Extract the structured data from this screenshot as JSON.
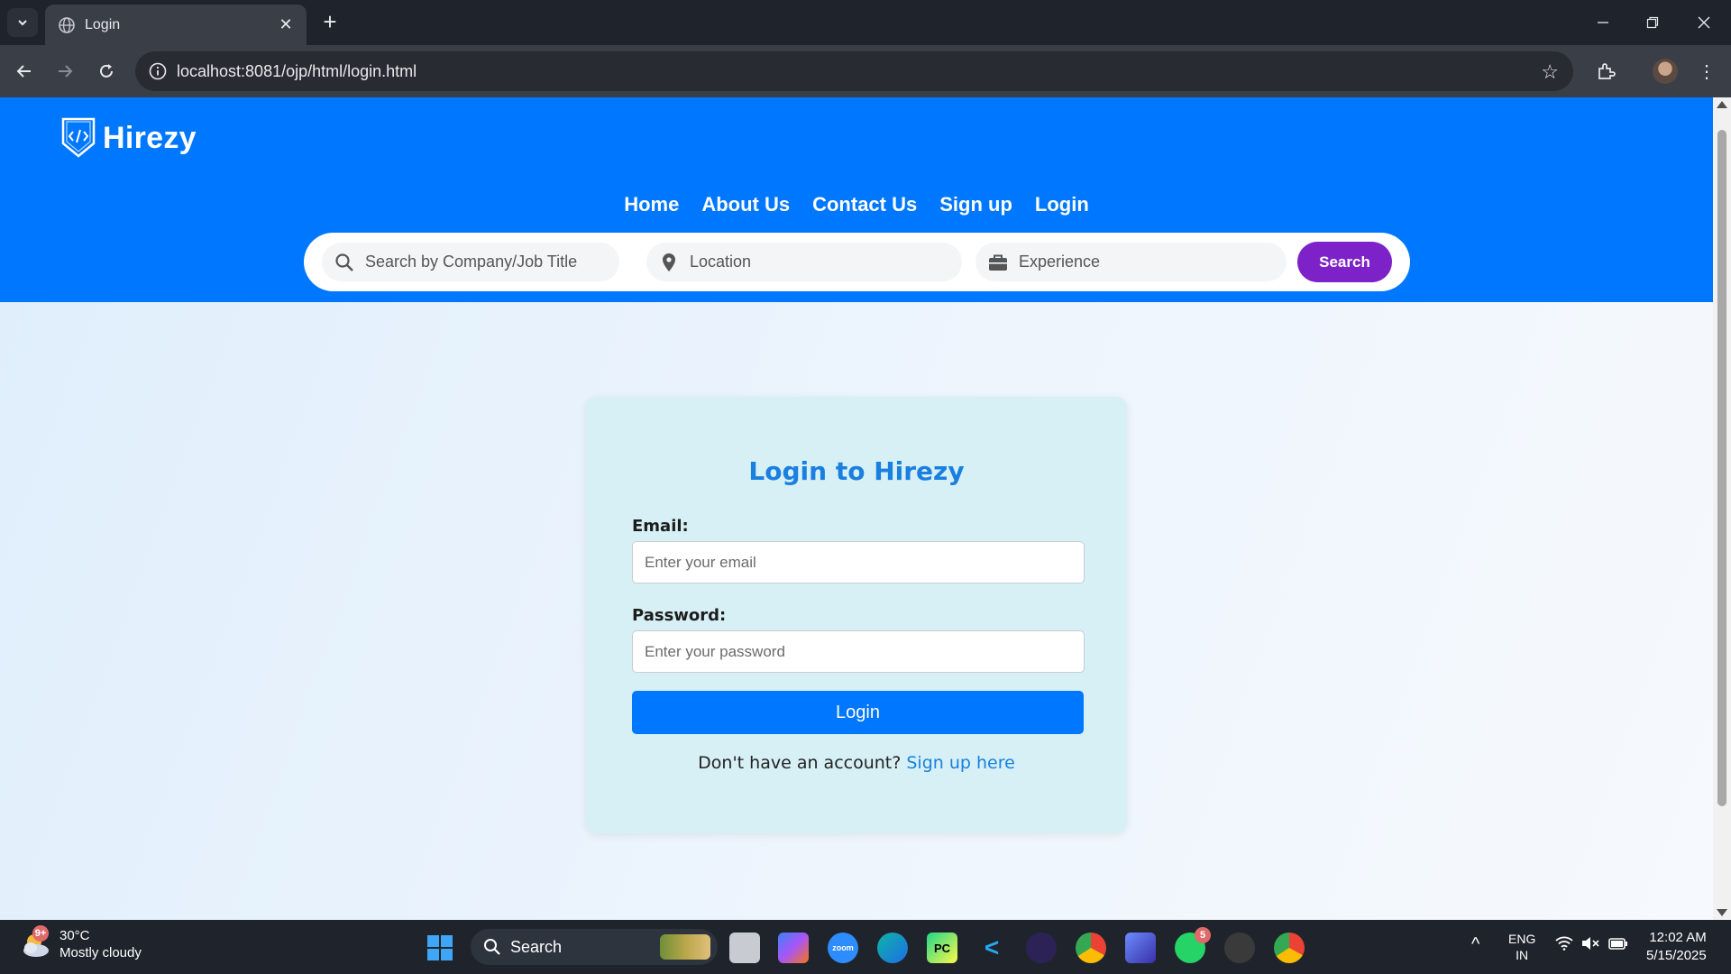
{
  "browser": {
    "tab_title": "Login",
    "url": "localhost:8081/ojp/html/login.html"
  },
  "site": {
    "brand": "Hirezy",
    "nav": [
      "Home",
      "About Us",
      "Contact Us",
      "Sign up",
      "Login"
    ],
    "search": {
      "company_placeholder": "Search by Company/Job Title",
      "location_placeholder": "Location",
      "experience_placeholder": "Experience",
      "button_label": "Search"
    }
  },
  "login": {
    "title": "Login to Hirezy",
    "email_label": "Email:",
    "email_placeholder": "Enter your email",
    "password_label": "Password:",
    "password_placeholder": "Enter your password",
    "submit_label": "Login",
    "signup_prompt": "Don't have an account?",
    "signup_link": "Sign up here"
  },
  "taskbar": {
    "weather_temp": "30°C",
    "weather_desc": "Mostly cloudy",
    "weather_badge": "9+",
    "search_label": "Search",
    "whatsapp_badge": "5",
    "lang_top": "ENG",
    "lang_bottom": "IN",
    "time": "12:02 AM",
    "date": "5/15/2025",
    "zoom_label": "zoom"
  },
  "colors": {
    "header_blue": "#0077ff",
    "search_purple": "#7d22c9",
    "card_bg": "#d6f0f5",
    "title_blue": "#1a7fe0"
  }
}
